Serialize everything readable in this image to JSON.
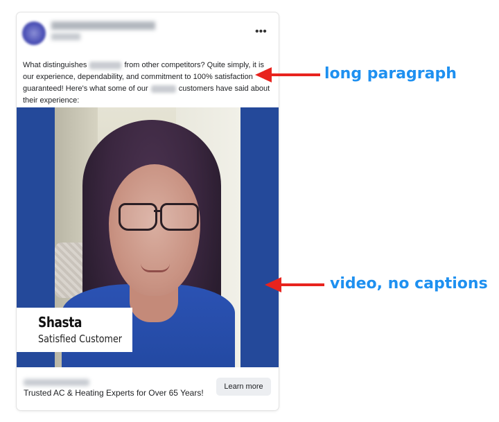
{
  "post": {
    "more_icon": "more-horizontal-icon",
    "paragraph": {
      "part1": "What distinguishes ",
      "part2": " from other competitors? Quite simply, it is our experience, dependability, and commitment to 100% satisfaction guaranteed! Here's what some of our ",
      "part3": " customers have said about their experience:"
    }
  },
  "video": {
    "name": "Shasta",
    "caption": "Satisfied Customer",
    "side_color": "#24499a"
  },
  "footer": {
    "headline": "Trusted AC & Heating Experts for Over 65 Years!",
    "cta_label": "Learn more"
  },
  "annotations": [
    {
      "label": "long paragraph",
      "color": "#e8231e"
    },
    {
      "label": "video, no captions",
      "color": "#e8231e"
    }
  ],
  "colors": {
    "annotation_text": "#1e90f0",
    "arrow": "#e8231e"
  }
}
